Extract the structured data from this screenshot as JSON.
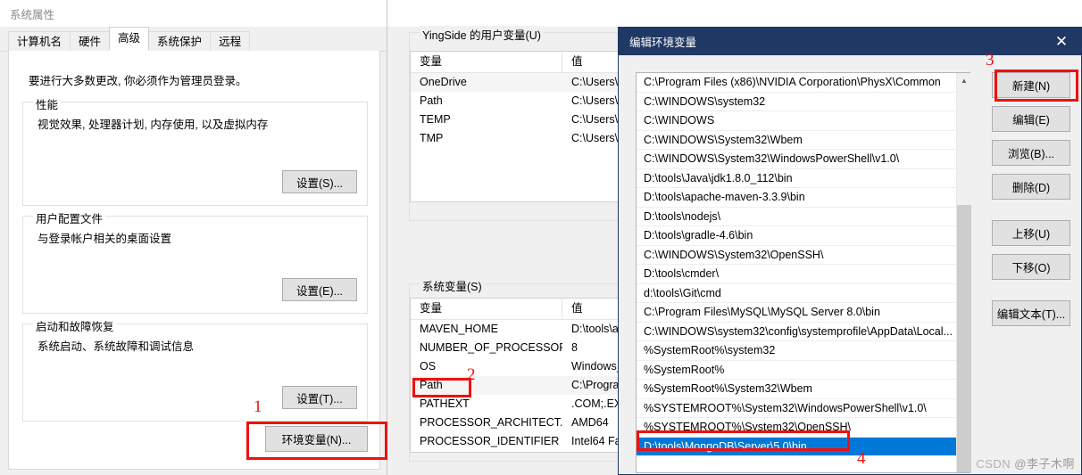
{
  "system_properties": {
    "title": "系统属性",
    "tabs": [
      {
        "label": "计算机名",
        "active": false
      },
      {
        "label": "硬件",
        "active": false
      },
      {
        "label": "高级",
        "active": true
      },
      {
        "label": "系统保护",
        "active": false
      },
      {
        "label": "远程",
        "active": false
      }
    ],
    "intro": "要进行大多数更改, 你必须作为管理员登录。",
    "groups": [
      {
        "legend": "性能",
        "desc": "视觉效果, 处理器计划, 内存使用, 以及虚拟内存",
        "button": "设置(S)..."
      },
      {
        "legend": "用户配置文件",
        "desc": "与登录帐户相关的桌面设置",
        "button": "设置(E)..."
      },
      {
        "legend": "启动和故障恢复",
        "desc": "系统启动、系统故障和调试信息",
        "button": "设置(T)..."
      }
    ],
    "env_button": "环境变量(N)..."
  },
  "env_variables": {
    "user_group_legend": "YingSide 的用户变量(U)",
    "system_group_legend": "系统变量(S)",
    "columns": {
      "variable": "变量",
      "value": "值"
    },
    "user_rows": [
      {
        "name": "OneDrive",
        "value": "C:\\Users\\Y"
      },
      {
        "name": "Path",
        "value": "C:\\Users\\Y"
      },
      {
        "name": "TEMP",
        "value": "C:\\Users\\Y"
      },
      {
        "name": "TMP",
        "value": "C:\\Users\\Y"
      }
    ],
    "system_rows": [
      {
        "name": "MAVEN_HOME",
        "value": "D:\\tools\\a"
      },
      {
        "name": "NUMBER_OF_PROCESSORS",
        "value": "8"
      },
      {
        "name": "OS",
        "value": "Windows_"
      },
      {
        "name": "Path",
        "value": "C:\\Progra"
      },
      {
        "name": "PATHEXT",
        "value": ".COM;.EXE"
      },
      {
        "name": "PROCESSOR_ARCHITECT...",
        "value": "AMD64"
      },
      {
        "name": "PROCESSOR_IDENTIFIER",
        "value": "Intel64 Fa"
      }
    ]
  },
  "edit_env": {
    "title": "编辑环境变量",
    "close_icon": "close-icon",
    "paths": [
      "C:\\Program Files (x86)\\NVIDIA Corporation\\PhysX\\Common",
      "C:\\WINDOWS\\system32",
      "C:\\WINDOWS",
      "C:\\WINDOWS\\System32\\Wbem",
      "C:\\WINDOWS\\System32\\WindowsPowerShell\\v1.0\\",
      "D:\\tools\\Java\\jdk1.8.0_112\\bin",
      "D:\\tools\\apache-maven-3.3.9\\bin",
      "D:\\tools\\nodejs\\",
      "D:\\tools\\gradle-4.6\\bin",
      "C:\\WINDOWS\\System32\\OpenSSH\\",
      "D:\\tools\\cmder\\",
      "d:\\tools\\Git\\cmd",
      "C:\\Program Files\\MySQL\\MySQL Server 8.0\\bin",
      "C:\\WINDOWS\\system32\\config\\systemprofile\\AppData\\Local...",
      "%SystemRoot%\\system32",
      "%SystemRoot%",
      "%SystemRoot%\\System32\\Wbem",
      "%SYSTEMROOT%\\System32\\WindowsPowerShell\\v1.0\\",
      "%SYSTEMROOT%\\System32\\OpenSSH\\",
      "D:\\tools\\MongoDB\\Server\\5.0\\bin"
    ],
    "selected_index": 19,
    "buttons": [
      {
        "label": "新建(N)",
        "name": "new-button"
      },
      {
        "label": "编辑(E)",
        "name": "edit-button"
      },
      {
        "label": "浏览(B)...",
        "name": "browse-button"
      },
      {
        "label": "删除(D)",
        "name": "delete-button"
      },
      {
        "label": "上移(U)",
        "name": "move-up-button"
      },
      {
        "label": "下移(O)",
        "name": "move-down-button"
      },
      {
        "label": "编辑文本(T)...",
        "name": "edit-text-button"
      }
    ],
    "scroll_up_icon": "chevron-up-icon"
  },
  "annotations": {
    "marker_1": "1",
    "marker_2": "2",
    "marker_3": "3",
    "marker_4": "4",
    "color": "#ee1111"
  },
  "watermark": {
    "brand": "CSDN",
    "author": "@李子木啊"
  }
}
